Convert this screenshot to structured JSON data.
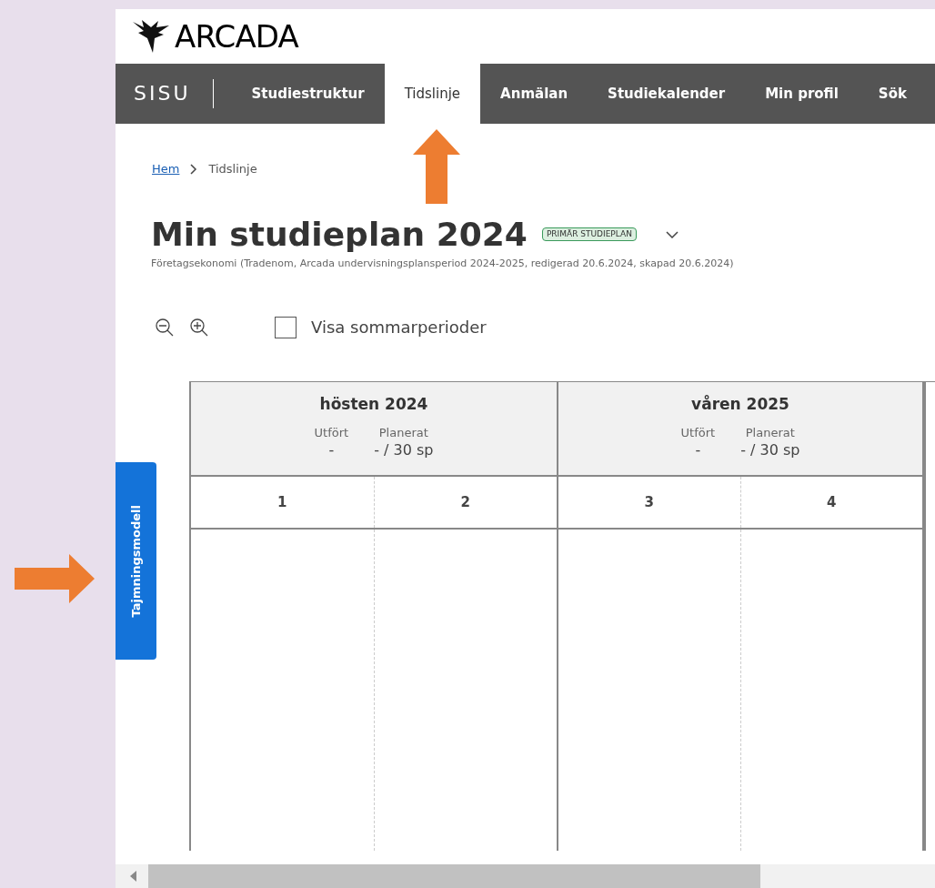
{
  "logo": {
    "text": "ARCADA"
  },
  "nav": {
    "brand": "SISU",
    "tabs": [
      {
        "label": "Studiestruktur",
        "selected": false
      },
      {
        "label": "Tidslinje",
        "selected": true
      },
      {
        "label": "Anmälan",
        "selected": false
      },
      {
        "label": "Studiekalender",
        "selected": false
      },
      {
        "label": "Min profil",
        "selected": false
      },
      {
        "label": "Sök",
        "selected": false
      }
    ]
  },
  "side_tab": {
    "label": "Tajmningsmodell"
  },
  "breadcrumb": [
    {
      "label": "Hem",
      "kind": "link"
    },
    {
      "label": "Tidslinje",
      "kind": "current"
    }
  ],
  "title": "Min studieplan 2024",
  "badge": "PRIMÄR STUDIEPLAN",
  "subtitle": "Företagsekonomi (Tradenom, Arcada undervisningsplansperiod 2024-2025, redigerad 20.6.2024, skapad 20.6.2024)",
  "toolbar": {
    "summer_checkbox": {
      "label": "Visa sommarperioder",
      "checked": false
    }
  },
  "timeline": {
    "terms": [
      {
        "name": "hösten 2024",
        "done_label": "Utfört",
        "done_value": "-",
        "planned_label": "Planerat",
        "planned_value": "- / 30 sp",
        "periods": [
          "1",
          "2"
        ]
      },
      {
        "name": "våren 2025",
        "done_label": "Utfört",
        "done_value": "-",
        "planned_label": "Planerat",
        "planned_value": "- / 30 sp",
        "periods": [
          "3",
          "4"
        ]
      }
    ]
  }
}
